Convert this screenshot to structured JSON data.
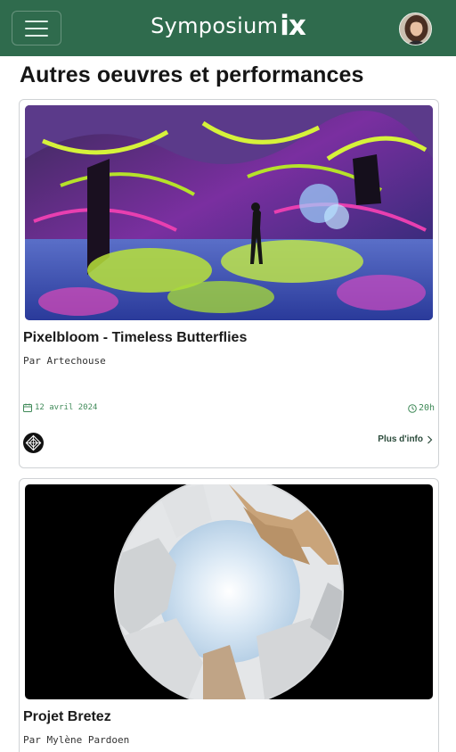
{
  "header": {
    "brand_word": "Symposium",
    "brand_mark": "ix",
    "menu_icon": "hamburger-menu-icon",
    "avatar_icon": "user-avatar",
    "background_color": "#2f6b4d"
  },
  "page": {
    "title": "Autres oeuvres et performances"
  },
  "cards": [
    {
      "title": "Pixelbloom - Timeless Butterflies",
      "artist": "Par Artechouse",
      "date": "12 avril 2024",
      "time": "20h",
      "more_label": "Plus d'info",
      "image": "immersive-butterfly-projection-room",
      "organizer_icon": "geometric-logo-icon"
    },
    {
      "title": "Projet Bretez",
      "artist": "Par Mylène Pardoen",
      "image": "fisheye-street-buildings-sphere"
    }
  ],
  "colors": {
    "accent": "#3f8a58",
    "link": "#2a4a3a",
    "card_border": "#cfd2d5"
  }
}
